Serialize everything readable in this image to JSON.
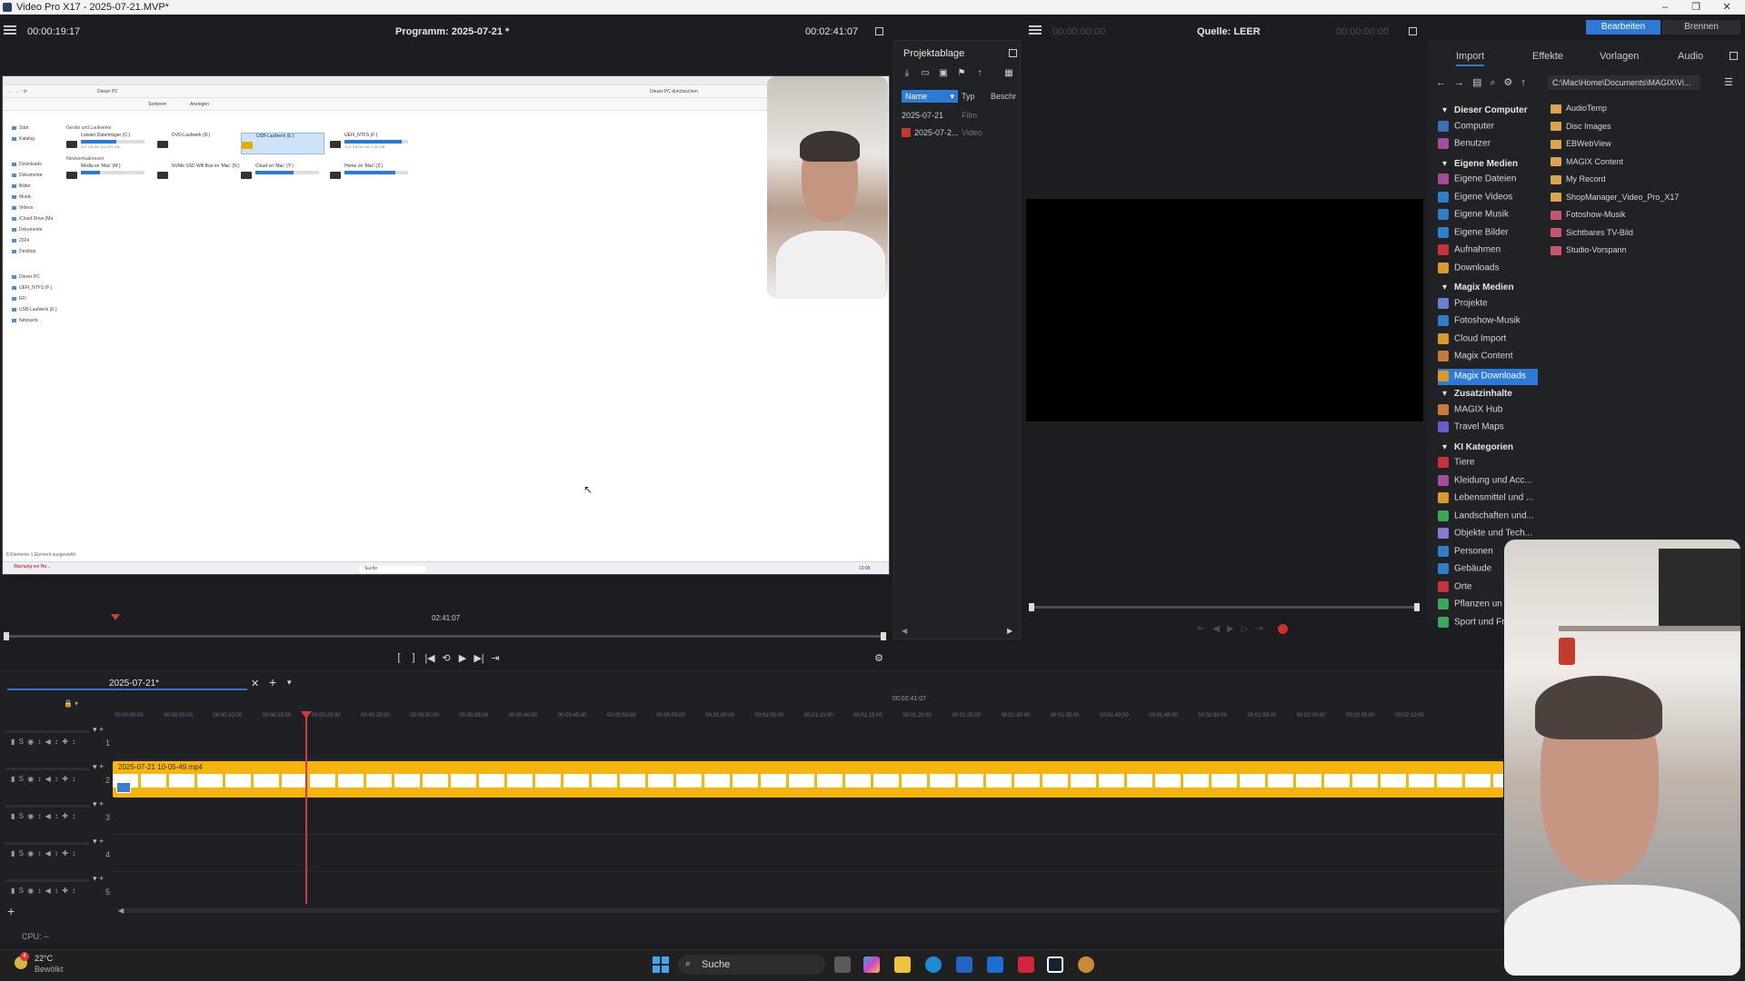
{
  "window": {
    "title": "Video Pro X17 - 2025-07-21.MVP*"
  },
  "program": {
    "timecode": "00:00:19:17",
    "title": "Programm: 2025-07-21 *",
    "duration": "00:02:41:07",
    "scrub_time": "02:41:07"
  },
  "pool": {
    "title": "Projektablage",
    "columns": [
      "Name",
      "Typ",
      "Beschr"
    ],
    "rows": [
      {
        "name": "2025-07-21",
        "type": "Film"
      },
      {
        "name": "2025-07-2...",
        "type": "Video"
      }
    ]
  },
  "source": {
    "timecode_left": "00:00:00:00",
    "title": "Quelle: LEER",
    "timecode_right": "00:00:00:00"
  },
  "mode_buttons": {
    "edit": "Bearbeiten",
    "burn": "Brennen"
  },
  "right_tabs": [
    "Import",
    "Effekte",
    "Vorlagen",
    "Audio"
  ],
  "path": "C:\\Mac\\Home\\Documents\\MAGIX\\Vi...",
  "tree": {
    "dieser_computer": {
      "label": "Dieser Computer",
      "items": [
        "Computer",
        "Benutzer"
      ]
    },
    "eigene_medien": {
      "label": "Eigene Medien",
      "items": [
        "Eigene Dateien",
        "Eigene Videos",
        "Eigene Musik",
        "Eigene Bilder",
        "Aufnahmen",
        "Downloads"
      ]
    },
    "magix_medien": {
      "label": "Magix Medien",
      "items": [
        "Projekte",
        "Fotoshow-Musik",
        "Cloud Import",
        "Magix Content",
        "Magix Downloads"
      ]
    },
    "zusatzinhalte": {
      "label": "Zusatzinhalte",
      "items": [
        "MAGIX Hub",
        "Travel Maps"
      ]
    },
    "ki_kategorien": {
      "label": "KI Kategorien",
      "items": [
        "Tiere",
        "Kleidung und Acc...",
        "Lebensmittel und ...",
        "Landschaften und...",
        "Objekte und Tech...",
        "Personen",
        "Gebäude",
        "Orte",
        "Pflanzen un",
        "Sport und Fr"
      ]
    }
  },
  "folders": [
    "AudioTemp",
    "Disc Images",
    "EBWebView",
    "MAGIX Content",
    "My Record",
    "ShopManager_Video_Pro_X17",
    "Fotoshow-Musik",
    "Sichtbares TV-Bild",
    "Studio-Vorspann"
  ],
  "timeline": {
    "tab": "2025-07-21*",
    "marker_time": "00:02:41:07",
    "ruler": [
      "00:00:00:00",
      "00:00:05:00",
      "00:00:10:00",
      "00:00:15:00",
      "00:00:20:00",
      "00:00:25:00",
      "00:00:30:00",
      "00:00:35:00",
      "00:00:40:00",
      "00:00:45:00",
      "00:00:50:00",
      "00:00:55:00",
      "00:01:00:00",
      "00:01:05:00",
      "00:01:10:00",
      "00:01:15:00",
      "00:01:20:00",
      "00:01:25:00",
      "00:01:30:00",
      "00:01:35:00",
      "00:01:40:00",
      "00:01:45:00",
      "00:01:50:00",
      "00:01:55:00",
      "00:02:00:00",
      "00:02:05:00",
      "00:02:10:00"
    ],
    "tracks": [
      "1",
      "2",
      "3",
      "4",
      "5"
    ],
    "track_letter": "S",
    "clip_name": "2025-07-21 10-05-49.mp4"
  },
  "status": {
    "cpu": "CPU: --"
  },
  "taskbar": {
    "temp": "22°C",
    "weather": "Bewölkt",
    "badge": "4",
    "search": "Suche"
  },
  "inset": {
    "address": "Dieser PC",
    "search": "Dieser PC durchsuchen",
    "section1": "Geräte und Laufwerke",
    "section2": "Netzwerkadressen",
    "toolbar": [
      "Sortieren",
      "Anzeigen"
    ],
    "sidebar": [
      "Start",
      "Katalog",
      "Downloads",
      "Dokumente",
      "Bilder",
      "Musik",
      "Videos",
      "iCloud Drive (Ma",
      "Dokumente",
      "2024",
      "Desktop",
      "Dieser PC",
      "UEFI_NTFS (F:)",
      "EFI",
      "USB-Laufwerk (E:)",
      "Netzwerk"
    ],
    "drives": [
      {
        "name": "Lokaler Datenträger (C:)",
        "size": "107 GB frei von 233 GB",
        "fill": 0.55
      },
      {
        "name": "DVD-Laufwerk (D:)",
        "size": "",
        "fill": 0
      },
      {
        "name": "USB-Laufwerk (E:)",
        "size": "",
        "fill": 0
      },
      {
        "name": "UEFI_NTFS (F:)",
        "size": "1,22 KB frei von 1,00 MB",
        "fill": 0.9
      },
      {
        "name": "Media on 'Mac' (M:)",
        "size": "",
        "fill": 0.3
      },
      {
        "name": "NVMe SSD Wifi Bus on 'Mac' (N:)",
        "size": "",
        "fill": 0.2
      },
      {
        "name": "Cloud on 'Mac' (Y:)",
        "size": "",
        "fill": 0.6
      },
      {
        "name": "Home on 'Mac' (Z:)",
        "size": "",
        "fill": 0.8
      }
    ],
    "statusbar": "8 Elemente   1 Element ausgewählt",
    "taskbar_search": "Suche",
    "warning": "Warnung vor Re...",
    "clock": "10:05"
  }
}
